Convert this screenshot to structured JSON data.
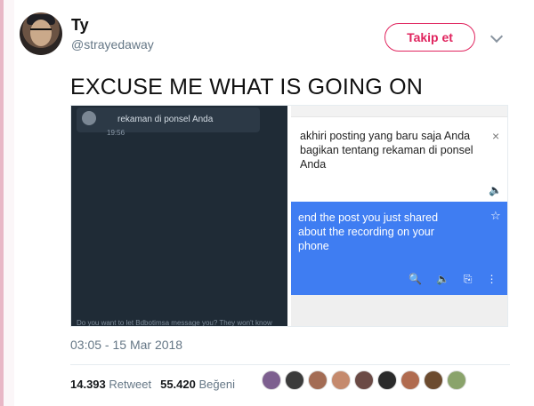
{
  "tweet": {
    "display_name": "Ty",
    "handle": "@strayedaway",
    "follow_label": "Takip et",
    "text": "EXCUSE ME WHAT IS GOING ON",
    "timestamp": "03:05 - 15 Mar 2018",
    "retweets_count": "14.393",
    "retweets_label": "Retweet",
    "likes_count": "55.420",
    "likes_label": "Beğeni"
  },
  "media": {
    "message_line": "rekaman di ponsel Anda",
    "message_time": "19:56",
    "message_footer": "Do you want to let Bdbotimsa message you? They won't know",
    "translate_source": "akhiri posting yang baru saja Anda bagikan tentang rekaman di ponsel Anda",
    "translate_target": "end the post you just shared about the recording on your phone"
  },
  "icons": {
    "chevron": "chevron-down-icon",
    "close": "close-icon",
    "speaker": "speaker-icon",
    "star": "star-icon",
    "search": "search-icon",
    "copy": "copy-icon",
    "more": "more-vertical-icon"
  },
  "colors": {
    "follow": "#e0245e",
    "dark_chat": "#1f2b36",
    "translate_blue": "#3f7df2"
  },
  "likers": [
    {
      "color": "#7d5f8f"
    },
    {
      "color": "#3b3b3b"
    },
    {
      "color": "#a36c54"
    },
    {
      "color": "#c58a6d"
    },
    {
      "color": "#6b4a45"
    },
    {
      "color": "#2b2b2b"
    },
    {
      "color": "#b06b4f"
    },
    {
      "color": "#6c4b2f"
    },
    {
      "color": "#8aa36b"
    }
  ]
}
